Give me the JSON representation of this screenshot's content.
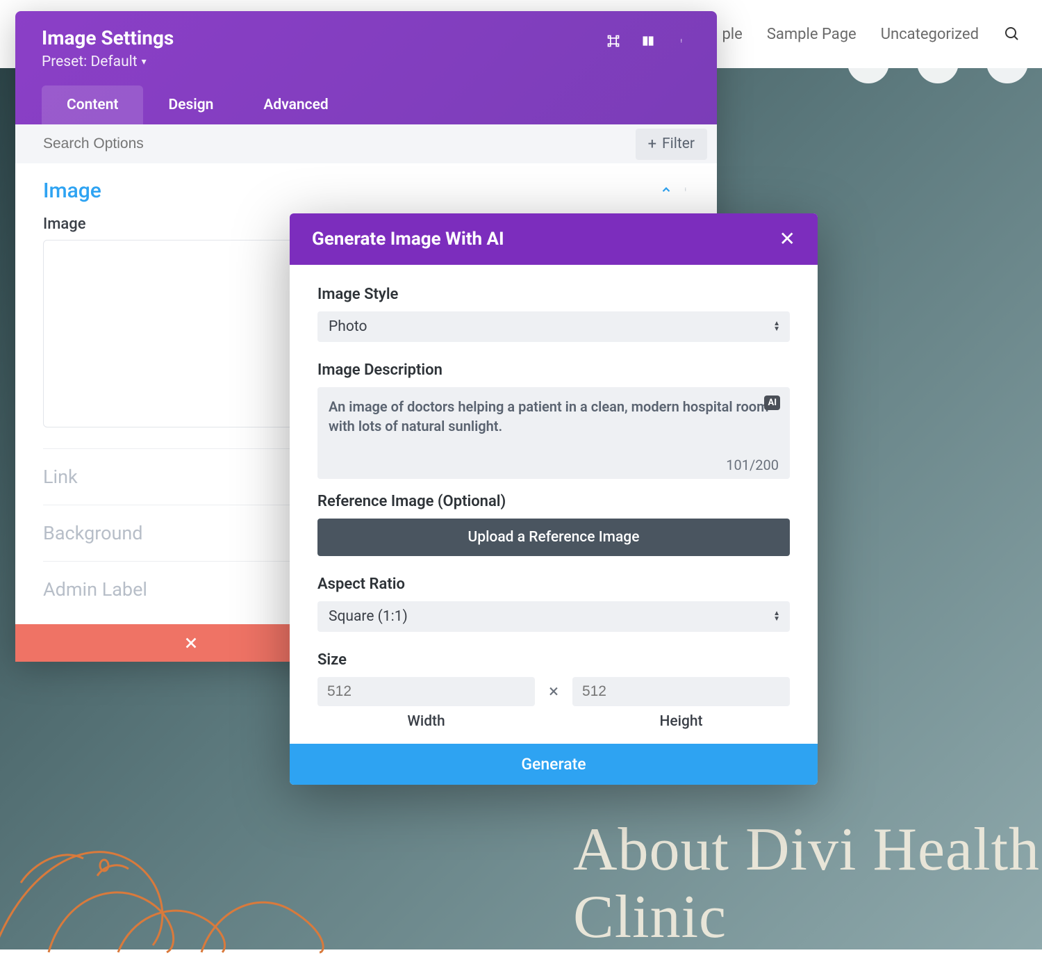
{
  "topNav": {
    "items": [
      "ple",
      "Sample Page",
      "Uncategorized"
    ]
  },
  "hero": {
    "title": "About Divi Health Clinic"
  },
  "settingsPanel": {
    "title": "Image Settings",
    "presetLabel": "Preset: Default",
    "tabs": [
      "Content",
      "Design",
      "Advanced"
    ],
    "activeTab": 0,
    "searchPlaceholder": "Search Options",
    "filterLabel": "Filter",
    "imageSection": {
      "title": "Image",
      "fieldLabel": "Image"
    },
    "collapsedSections": [
      "Link",
      "Background",
      "Admin Label"
    ]
  },
  "aiModal": {
    "title": "Generate Image With AI",
    "fields": {
      "styleLabel": "Image Style",
      "styleValue": "Photo",
      "descLabel": "Image Description",
      "descValue": "An image of doctors helping a patient in a clean, modern hospital room with lots of natural sunlight.",
      "aiBadge": "AI",
      "descCounter": "101/200",
      "refLabel": "Reference Image (Optional)",
      "uploadLabel": "Upload a Reference Image",
      "aspectLabel": "Aspect Ratio",
      "aspectValue": "Square (1:1)",
      "sizeLabel": "Size",
      "widthPlaceholder": "512",
      "heightPlaceholder": "512",
      "widthLabel": "Width",
      "heightLabel": "Height",
      "sizeX": "×"
    },
    "generateLabel": "Generate"
  }
}
